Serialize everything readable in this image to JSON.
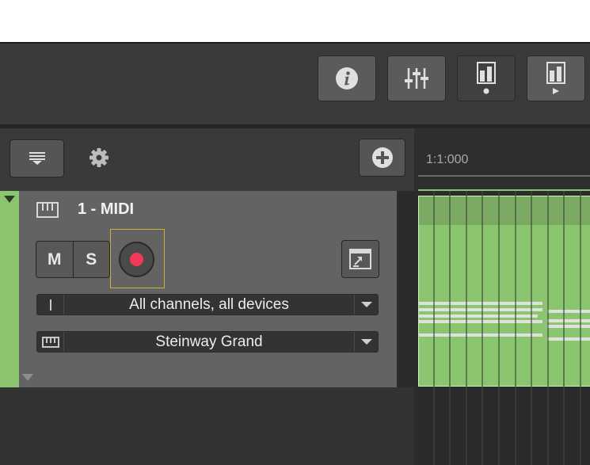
{
  "toolbar": {
    "buttons": [
      {
        "name": "info-button",
        "icon": "info-icon"
      },
      {
        "name": "mixer-button",
        "icon": "sliders-icon"
      },
      {
        "name": "meter-button",
        "icon": "meter-dot-icon"
      },
      {
        "name": "meter-play-button",
        "icon": "meter-play-icon"
      }
    ]
  },
  "track_header": {
    "menu_icon": "track-list-menu-icon",
    "settings_icon": "gear-icon",
    "add_icon": "add-track-icon"
  },
  "ruler": {
    "position_label": "1:1:000"
  },
  "track": {
    "name": "1 - MIDI",
    "type_icon": "piano-keyboard-icon",
    "mute_label": "M",
    "solo_label": "S",
    "record_icon": "record-icon",
    "monitor_icon": "monitor-icon",
    "input": {
      "value": "All channels, all devices",
      "icon": "input-icon"
    },
    "instrument": {
      "value": "Steinway Grand",
      "icon": "piano-keyboard-icon"
    }
  },
  "colors": {
    "track_color": "#8cc56f",
    "record_dot": "#f2395a",
    "arm_highlight": "#c9b23a"
  }
}
